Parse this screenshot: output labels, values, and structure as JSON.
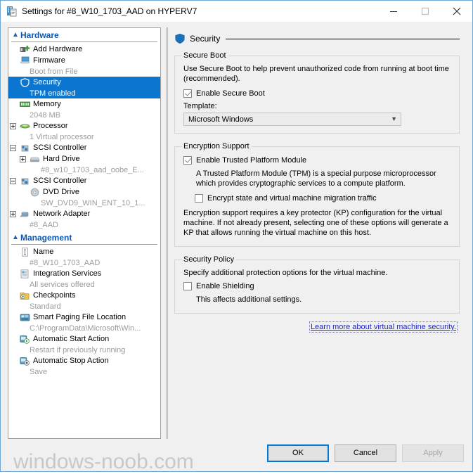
{
  "window": {
    "title": "Settings for #8_W10_1703_AAD on HYPERV7",
    "icon": "hyperv-settings-icon",
    "controls": {
      "minimize": "minimize-icon",
      "maximize": "maximize-icon",
      "close": "close-icon"
    }
  },
  "sidebar": {
    "sections": [
      {
        "label": "Hardware",
        "items": [
          {
            "label": "Add Hardware",
            "sub": null,
            "icon": "add-hardware-icon",
            "expander": null,
            "indent": 0,
            "selected": false
          },
          {
            "label": "Firmware",
            "sub": "Boot from File",
            "icon": "firmware-icon",
            "expander": null,
            "indent": 0,
            "selected": false
          },
          {
            "label": "Security",
            "sub": "TPM enabled",
            "icon": "shield-icon",
            "expander": null,
            "indent": 0,
            "selected": true
          },
          {
            "label": "Memory",
            "sub": "2048 MB",
            "icon": "memory-icon",
            "expander": null,
            "indent": 0,
            "selected": false
          },
          {
            "label": "Processor",
            "sub": "1 Virtual processor",
            "icon": "processor-icon",
            "expander": "plus",
            "indent": 0,
            "selected": false
          },
          {
            "label": "SCSI Controller",
            "sub": null,
            "icon": "scsi-controller-icon",
            "expander": "minus",
            "indent": 0,
            "selected": false
          },
          {
            "label": "Hard Drive",
            "sub": "#8_w10_1703_aad_oobe_E...",
            "icon": "hard-drive-icon",
            "expander": "plus",
            "indent": 1,
            "selected": false
          },
          {
            "label": "SCSI Controller",
            "sub": null,
            "icon": "scsi-controller-icon",
            "expander": "minus",
            "indent": 0,
            "selected": false
          },
          {
            "label": "DVD Drive",
            "sub": "SW_DVD9_WIN_ENT_10_1...",
            "icon": "dvd-drive-icon",
            "expander": null,
            "indent": 1,
            "selected": false
          },
          {
            "label": "Network Adapter",
            "sub": "#8_AAD",
            "icon": "network-adapter-icon",
            "expander": "plus",
            "indent": 0,
            "selected": false
          }
        ]
      },
      {
        "label": "Management",
        "items": [
          {
            "label": "Name",
            "sub": "#8_W10_1703_AAD",
            "icon": "name-icon",
            "expander": null,
            "indent": 0,
            "selected": false
          },
          {
            "label": "Integration Services",
            "sub": "All services offered",
            "icon": "integration-services-icon",
            "expander": null,
            "indent": 0,
            "selected": false
          },
          {
            "label": "Checkpoints",
            "sub": "Standard",
            "icon": "checkpoints-icon",
            "expander": null,
            "indent": 0,
            "selected": false
          },
          {
            "label": "Smart Paging File Location",
            "sub": "C:\\ProgramData\\Microsoft\\Win...",
            "icon": "smart-paging-icon",
            "expander": null,
            "indent": 0,
            "selected": false
          },
          {
            "label": "Automatic Start Action",
            "sub": "Restart if previously running",
            "icon": "auto-start-icon",
            "expander": null,
            "indent": 0,
            "selected": false
          },
          {
            "label": "Automatic Stop Action",
            "sub": "Save",
            "icon": "auto-stop-icon",
            "expander": null,
            "indent": 0,
            "selected": false
          }
        ]
      }
    ]
  },
  "main": {
    "page_title": "Security",
    "page_icon": "shield-icon",
    "secure_boot": {
      "legend": "Secure Boot",
      "description": "Use Secure Boot to help prevent unauthorized code from running at boot time (recommended).",
      "enable_checkbox": {
        "label_pre": "E",
        "label_accel": "n",
        "label_post": "able Secure Boot",
        "label": "Enable Secure Boot",
        "checked": true
      },
      "template_label": "Template:",
      "template_value": "Microsoft Windows",
      "template_chevron": "chevron-down-icon"
    },
    "encryption_support": {
      "legend": "Encryption Support",
      "tpm_checkbox": {
        "label": "Enable Trusted Platform Module",
        "checked": true
      },
      "tpm_description": "A Trusted Platform Module (TPM) is a special purpose microprocessor which provides cryptographic services to a compute platform.",
      "encrypt_checkbox": {
        "label": "Encrypt state and virtual machine migration traffic",
        "checked": false
      },
      "footer_description": "Encryption support requires a key protector (KP) configuration for the virtual machine. If not already present, selecting one of these options will generate a KP that allows running the virtual machine on this host."
    },
    "security_policy": {
      "legend": "Security Policy",
      "description": "Specify additional protection options for the virtual machine.",
      "shielding_checkbox": {
        "label": "Enable Shielding",
        "checked": false
      },
      "shielding_note": "This affects additional settings."
    },
    "help_link": "Learn more about virtual machine security."
  },
  "footer": {
    "ok": "OK",
    "cancel": "Cancel",
    "apply": "Apply",
    "apply_disabled": true,
    "watermark": "windows-noob.com"
  },
  "annotation": {
    "arrow": "red-left-arrow-annotation",
    "color": "#e31e24"
  },
  "colors": {
    "selection_blue": "#0b76d0",
    "section_header_blue": "#0a58b0",
    "link_blue": "#1a28c8",
    "accent_focus": "#0078d7",
    "annotation_red": "#e31e24",
    "panel_bg": "#f0f0f0"
  }
}
